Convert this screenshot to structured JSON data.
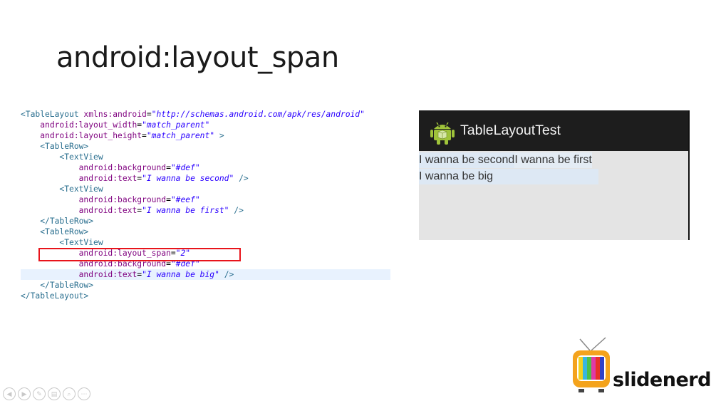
{
  "slide": {
    "title": "android:layout_span"
  },
  "code": [
    [
      [
        "tag",
        "<TableLayout "
      ],
      [
        "attr",
        "xmlns:android"
      ],
      [
        "pun",
        "="
      ],
      [
        "val",
        "\"http://schemas.android.com/apk/res/android\""
      ]
    ],
    [
      [
        "sp",
        "    "
      ],
      [
        "attr",
        "android:layout_width"
      ],
      [
        "pun",
        "="
      ],
      [
        "val",
        "\"match_parent\""
      ]
    ],
    [
      [
        "sp",
        "    "
      ],
      [
        "attr",
        "android:layout_height"
      ],
      [
        "pun",
        "="
      ],
      [
        "val",
        "\"match_parent\""
      ],
      [
        "tag",
        " >"
      ]
    ],
    [
      [
        "sp",
        "    "
      ],
      [
        "tag",
        "<TableRow>"
      ]
    ],
    [
      [
        "sp",
        "        "
      ],
      [
        "tag",
        "<TextView"
      ]
    ],
    [
      [
        "sp",
        "            "
      ],
      [
        "attr",
        "android:background"
      ],
      [
        "pun",
        "="
      ],
      [
        "val",
        "\"#def\""
      ]
    ],
    [
      [
        "sp",
        "            "
      ],
      [
        "attr",
        "android:text"
      ],
      [
        "pun",
        "="
      ],
      [
        "val",
        "\"I wanna be second\""
      ],
      [
        "tag",
        " />"
      ]
    ],
    [
      [
        "sp",
        "        "
      ],
      [
        "tag",
        "<TextView"
      ]
    ],
    [
      [
        "sp",
        "            "
      ],
      [
        "attr",
        "android:background"
      ],
      [
        "pun",
        "="
      ],
      [
        "val",
        "\"#eef\""
      ]
    ],
    [
      [
        "sp",
        "            "
      ],
      [
        "attr",
        "android:text"
      ],
      [
        "pun",
        "="
      ],
      [
        "val",
        "\"I wanna be first\""
      ],
      [
        "tag",
        " />"
      ]
    ],
    [
      [
        "sp",
        "    "
      ],
      [
        "tag",
        "</TableRow>"
      ]
    ],
    [
      [
        "sp",
        "    "
      ],
      [
        "tag",
        "<TableRow>"
      ]
    ],
    [
      [
        "sp",
        "        "
      ],
      [
        "tag",
        "<TextView"
      ]
    ],
    [
      [
        "sp",
        "            "
      ],
      [
        "attr",
        "android:layout_span"
      ],
      [
        "pun",
        "="
      ],
      [
        "val",
        "\"2\""
      ]
    ],
    [
      [
        "sp",
        "            "
      ],
      [
        "attr",
        "android:background"
      ],
      [
        "pun",
        "="
      ],
      [
        "val",
        "\"#def\""
      ]
    ],
    [
      [
        "sp",
        "            "
      ],
      [
        "attr",
        "android:text"
      ],
      [
        "pun",
        "="
      ],
      [
        "val",
        "\"I wanna be big\""
      ],
      [
        "tag",
        " />"
      ]
    ],
    [
      [
        "sp",
        "    "
      ],
      [
        "tag",
        "</TableRow>"
      ]
    ],
    [
      [
        "tag",
        "</TableLayout>"
      ]
    ]
  ],
  "highlighted_line": 15,
  "boxed_line": 13,
  "device": {
    "app_title": "TableLayoutTest",
    "row1": {
      "cell1": "I wanna be second",
      "cell2": "I wanna be first"
    },
    "row2": {
      "cell1": "I wanna be big"
    },
    "colors": {
      "def": "#dde8f4",
      "eef": "#e4ecf4",
      "action_bar": "#1d1d1d",
      "android_green": "#9fc33a"
    },
    "icon": "android-robot-icon"
  },
  "logo": {
    "text": "slidenerd",
    "icon": "tv-icon"
  },
  "toolbar": {
    "buttons": [
      {
        "icon": "prev-icon",
        "glyph": "◀"
      },
      {
        "icon": "next-icon",
        "glyph": "▶"
      },
      {
        "icon": "pen-icon",
        "glyph": "✎"
      },
      {
        "icon": "slides-icon",
        "glyph": "▤"
      },
      {
        "icon": "zoom-icon",
        "glyph": "⌕"
      },
      {
        "icon": "more-icon",
        "glyph": "⋯"
      }
    ]
  }
}
